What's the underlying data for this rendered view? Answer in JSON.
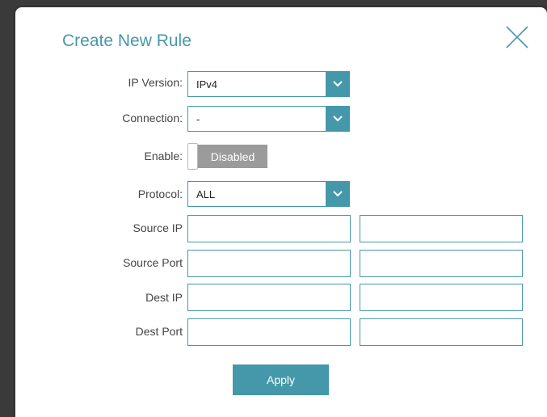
{
  "dialog": {
    "title": "Create New Rule",
    "close_icon": "close-icon"
  },
  "fields": {
    "ip_version": {
      "label": "IP Version:",
      "value": "IPv4"
    },
    "connection": {
      "label": "Connection:",
      "value": "-"
    },
    "enable": {
      "label": "Enable:",
      "state_text": "Disabled"
    },
    "protocol": {
      "label": "Protocol:",
      "value": "ALL"
    },
    "source_ip": {
      "label": "Source IP",
      "start": "",
      "end": ""
    },
    "source_port": {
      "label": "Source Port",
      "start": "",
      "end": ""
    },
    "dest_ip": {
      "label": "Dest IP",
      "start": "",
      "end": ""
    },
    "dest_port": {
      "label": "Dest Port",
      "start": "",
      "end": ""
    }
  },
  "actions": {
    "apply_label": "Apply"
  },
  "colors": {
    "accent": "#4598aa",
    "toggle_off": "#9b9b9b"
  }
}
